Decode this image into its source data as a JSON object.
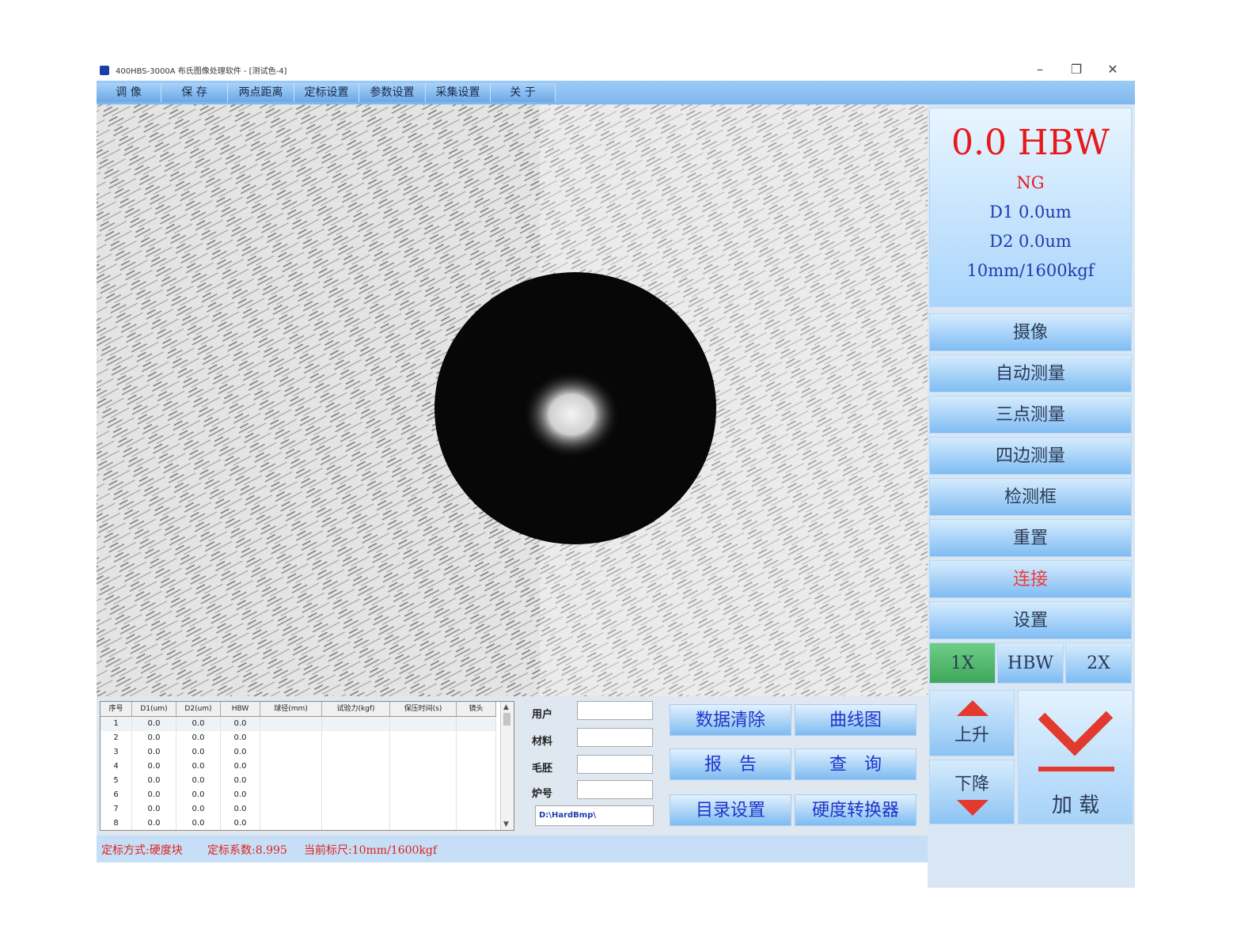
{
  "window": {
    "title": "400HBS-3000A 布氏图像处理软件 - [测试色-4]",
    "controls": [
      "–",
      "❐",
      "✕"
    ]
  },
  "menu": [
    "调 像",
    "保 存",
    "两点距离",
    "定标设置",
    "参数设置",
    "采集设置",
    "关 于"
  ],
  "readout": {
    "hardness": "0.0 HBW",
    "result": "NG",
    "d1": "D1 0.0um",
    "d2": "D2 0.0um",
    "ruler": "10mm/1600kgf",
    "colors": {
      "hardness": "#e6191b",
      "result": "#e6191b",
      "d1": "#1f3ab0",
      "d2": "#1f3ab0",
      "ruler": "#1f3ab0"
    }
  },
  "side_buttons": [
    {
      "label": "摄像",
      "color": "#2b3a57"
    },
    {
      "label": "自动测量",
      "color": "#2b3a57"
    },
    {
      "label": "三点测量",
      "color": "#2b3a57"
    },
    {
      "label": "四边测量",
      "color": "#2b3a57"
    },
    {
      "label": "检测框",
      "color": "#2b3a57"
    },
    {
      "label": "重置",
      "color": "#2b3a57"
    },
    {
      "label": "连接",
      "color": "#ee3b3b"
    },
    {
      "label": "设置",
      "color": "#2b3a57"
    }
  ],
  "zoom": {
    "x1": "1X",
    "unit": "HBW",
    "x2": "2X",
    "active_color": "#4fb86b"
  },
  "table": {
    "headers": [
      "序号",
      "D1(um)",
      "D2(um)",
      "HBW",
      "球径(mm)",
      "试验力(kgf)",
      "保压时间(s)",
      "镜头"
    ],
    "rows": [
      [
        "1",
        "0.0",
        "0.0",
        "0.0"
      ],
      [
        "2",
        "0.0",
        "0.0",
        "0.0"
      ],
      [
        "3",
        "0.0",
        "0.0",
        "0.0"
      ],
      [
        "4",
        "0.0",
        "0.0",
        "0.0"
      ],
      [
        "5",
        "0.0",
        "0.0",
        "0.0"
      ],
      [
        "6",
        "0.0",
        "0.0",
        "0.0"
      ],
      [
        "7",
        "0.0",
        "0.0",
        "0.0"
      ],
      [
        "8",
        "0.0",
        "0.0",
        "0.0"
      ]
    ]
  },
  "fields": {
    "labels": [
      "用户",
      "材料",
      "毛胚",
      "炉号"
    ],
    "values": [
      "",
      "",
      "",
      ""
    ],
    "path": "D:\\HardBmp\\"
  },
  "actions": [
    "数据清除",
    "曲线图",
    "报　告",
    "查　询",
    "目录设置",
    "硬度转换器"
  ],
  "motion": {
    "up": "上升",
    "down": "下降",
    "load": "加 载"
  },
  "status": {
    "method": "定标方式:硬度块",
    "coef": "定标系数:8.995",
    "ruler": "当前标尺:10mm/1600kgf"
  }
}
